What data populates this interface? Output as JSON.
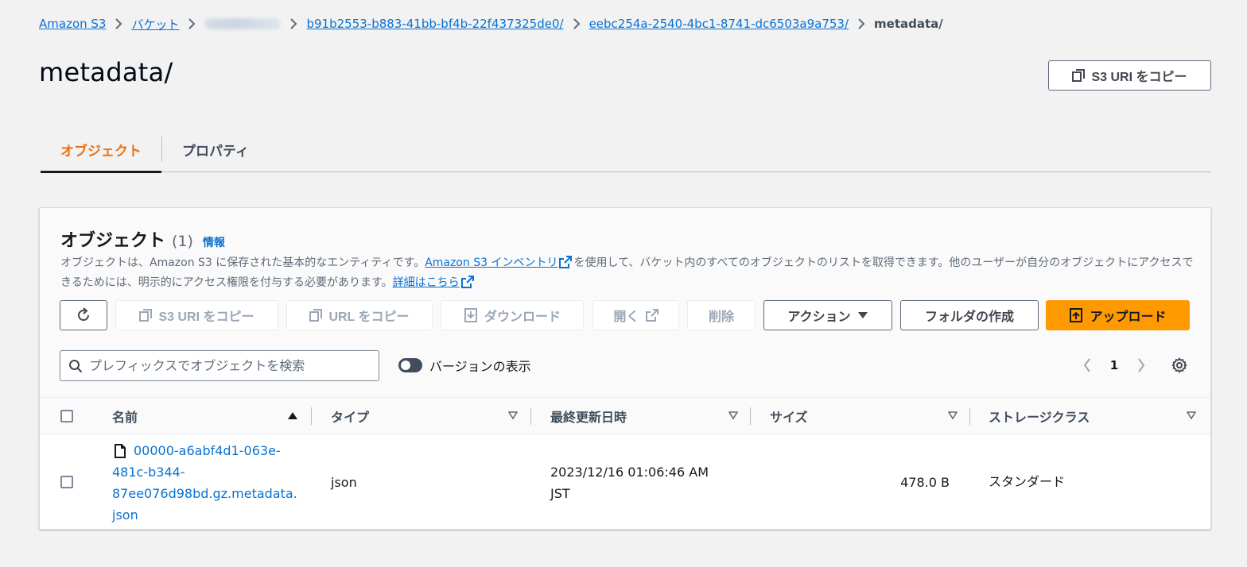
{
  "breadcrumb": {
    "items": [
      "Amazon S3",
      "バケット",
      "b91b2553-b883-41bb-bf4b-22f437325de0/",
      "eebc254a-2540-4bc1-8741-dc6503a9a753/"
    ],
    "current": "metadata/"
  },
  "header": {
    "title": "metadata/",
    "copy_uri_label": "S3 URI をコピー"
  },
  "tabs": [
    {
      "label": "オブジェクト",
      "active": true
    },
    {
      "label": "プロパティ",
      "active": false
    }
  ],
  "objects_panel": {
    "title": "オブジェクト",
    "count": "(1)",
    "info_label": "情報",
    "description": {
      "part1": "オブジェクトは、Amazon S3 に保存された基本的なエンティティです。",
      "link1": "Amazon S3 インベントリ",
      "part2": "を使用して、バケット内のすべてのオブジェクトのリストを取得できます。他のユーザーが自分のオブジェクトにアクセスできるためには、明示的にアクセス権限を付与する必要があります。",
      "link2": "詳細はこちら"
    },
    "toolbar": {
      "copy_s3_uri": "S3 URI をコピー",
      "copy_url": "URL をコピー",
      "download": "ダウンロード",
      "open": "開く",
      "delete": "削除",
      "actions": "アクション",
      "create_folder": "フォルダの作成",
      "upload": "アップロード"
    },
    "search": {
      "placeholder": "プレフィックスでオブジェクトを検索"
    },
    "version_toggle_label": "バージョンの表示",
    "pagination": {
      "current_page": "1"
    },
    "table": {
      "columns": [
        "名前",
        "タイプ",
        "最終更新日時",
        "サイズ",
        "ストレージクラス"
      ],
      "rows": [
        {
          "name_lines": [
            "00000-a6abf4d1-063e-",
            "481c-b344-",
            "87ee076d98bd.gz.metadata.",
            "json"
          ],
          "type": "json",
          "modified_lines": [
            "2023/12/16 01:06:46 AM",
            "JST"
          ],
          "size": "478.0 B",
          "storage_class": "スタンダード"
        }
      ]
    }
  },
  "colors": {
    "link": "#0972d3",
    "active_tab": "#ec7211",
    "primary_button": "#ff9900",
    "background": "#f2f2f2"
  }
}
